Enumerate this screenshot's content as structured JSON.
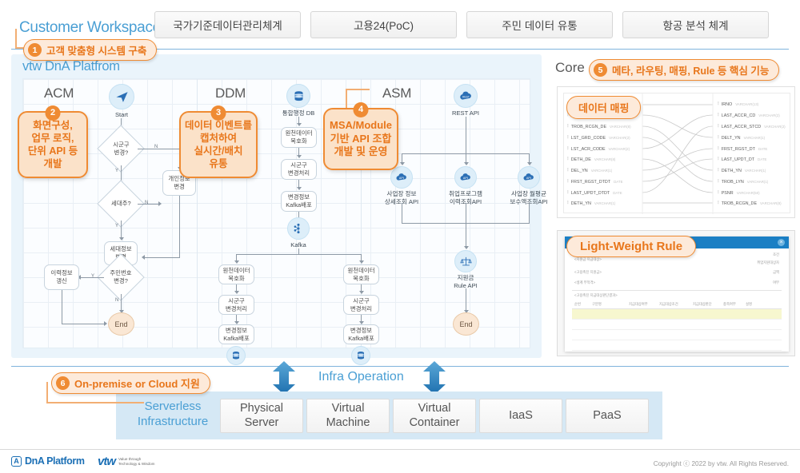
{
  "header": {
    "workspace_title": "Customer Workspace",
    "tabs": [
      {
        "label": "국가기준데이터관리체계"
      },
      {
        "label": "고용24(PoC)"
      },
      {
        "label": "주민 데이터 유통"
      },
      {
        "label": "항공 분석 체계"
      }
    ]
  },
  "callouts": {
    "c1": {
      "num": "1",
      "label": "고객 맞춤형 시스템 구축"
    },
    "c2": {
      "num": "2",
      "lines": [
        "화면구성,",
        "업무 로직,",
        "단위 API 등",
        "개발"
      ]
    },
    "c3": {
      "num": "3",
      "lines": [
        "데이터 이벤트를",
        "캡처하여",
        "실시간/배치",
        "유통"
      ]
    },
    "c4": {
      "num": "4",
      "lines": [
        "MSA/Module",
        "기반 API 조합",
        "개발 및 운영"
      ]
    },
    "c5": {
      "num": "5",
      "label": "메타, 라우팅, 매핑, Rule 등 핵심 기능"
    },
    "c6": {
      "num": "6",
      "label": "On-premise or Cloud 지원"
    }
  },
  "platform": {
    "title": "vtw DnA Platfrom",
    "sections": {
      "acm": "ACM",
      "ddm": "DDM",
      "asm": "ASM"
    },
    "acm": {
      "start": "Start",
      "d1": "시군구\n변경?",
      "d2": "세대주?",
      "n_personal": "개인정보\n변경",
      "n_household": "세대정보\n변경",
      "d3": "주민번호\n변경?",
      "n_history": "이력정보\n갱신",
      "end": "End",
      "yes": "Y",
      "no": "N"
    },
    "ddm": {
      "db_top": "통합행정 DB",
      "p1": "원천데이터\n복호화",
      "p2": "시군구\n변경처리",
      "p3": "변경정보\nKafka배포",
      "kafka": "Kafka",
      "lp1": "원천데이터\n복호화",
      "lp2": "시군구\n변경처리",
      "lp3": "변경정보\nKafka배포",
      "rp1": "원천데이터\n복호화",
      "rp2": "시군구\n변경처리",
      "rp3": "변경정보\nKafka배포"
    },
    "asm": {
      "rest": "REST API",
      "api1": "사업장 정보\n상세조회 API",
      "api2": "취업프로그램\n이력조회API",
      "api3": "사업장 월평균\n보수액조회API",
      "rule": "지원금\nRule API",
      "end": "End"
    }
  },
  "core": {
    "label": "Core",
    "mapping_badge": "데이터 매핑",
    "left_fields": [
      {
        "name": "",
        "type": ""
      },
      {
        "name": "",
        "type": ""
      },
      {
        "name": "TROB_RCGN_DE",
        "type": "VARCHAR(8)"
      },
      {
        "name": "LST_GRD_CODE",
        "type": "VARCHAR(2)"
      },
      {
        "name": "LST_ACR_CODE",
        "type": "VARCHAR(2)"
      },
      {
        "name": "DETH_DE",
        "type": "VARCHAR(8)"
      },
      {
        "name": "DEL_YN",
        "type": "VARCHAR(1)"
      },
      {
        "name": "FRST_RGST_DTDT",
        "type": "DATE"
      },
      {
        "name": "LAST_UPDT_DTDT",
        "type": "DATE"
      },
      {
        "name": "DETH_YN",
        "type": "VARCHAR(1)"
      }
    ],
    "right_fields": [
      {
        "name": "IRNO",
        "type": "VARCHAR(13)"
      },
      {
        "name": "LAST_ACCR_CD",
        "type": "VARCHAR(2)"
      },
      {
        "name": "LAST_ACCR_STCD",
        "type": "VARCHAR(2)"
      },
      {
        "name": "DELT_YN",
        "type": "VARCHAR(1)"
      },
      {
        "name": "FRST_RGST_DT",
        "type": "DATE"
      },
      {
        "name": "LAST_UPDT_DT",
        "type": "DATE"
      },
      {
        "name": "DETH_YN",
        "type": "VARCHAR(1)"
      },
      {
        "name": "TROB_LYN",
        "type": "VARCHAR(1)"
      },
      {
        "name": "PSNR",
        "type": "VARCHAR(50)"
      },
      {
        "name": "TROB_RCGN_DE",
        "type": "VARCHAR(8)"
      }
    ],
    "rule_badge": "Light-Weight Rule",
    "rule_close": "×"
  },
  "infra": {
    "operation_title": "Infra Operation",
    "serverless": "Serverless\nInfrastructure",
    "items": [
      {
        "label": "Physical\nServer"
      },
      {
        "label": "Virtual\nMachine"
      },
      {
        "label": "Virtual\nContainer"
      },
      {
        "label": "IaaS"
      },
      {
        "label": "PaaS"
      }
    ]
  },
  "footer": {
    "logo_mark": "A",
    "logo_text": "DnA Platform",
    "brand": "vtw",
    "brand_sub1": "Value through",
    "brand_sub2": "Technology & Wisdom",
    "copyright": "Copyright ⓒ 2022 by vtw. All Rights Reserved."
  },
  "colors": {
    "accent_blue": "#4a9fd4",
    "accent_orange": "#ef8b33",
    "panel_blue": "#eaf4fb",
    "infra_blue": "#d5e8f5"
  }
}
